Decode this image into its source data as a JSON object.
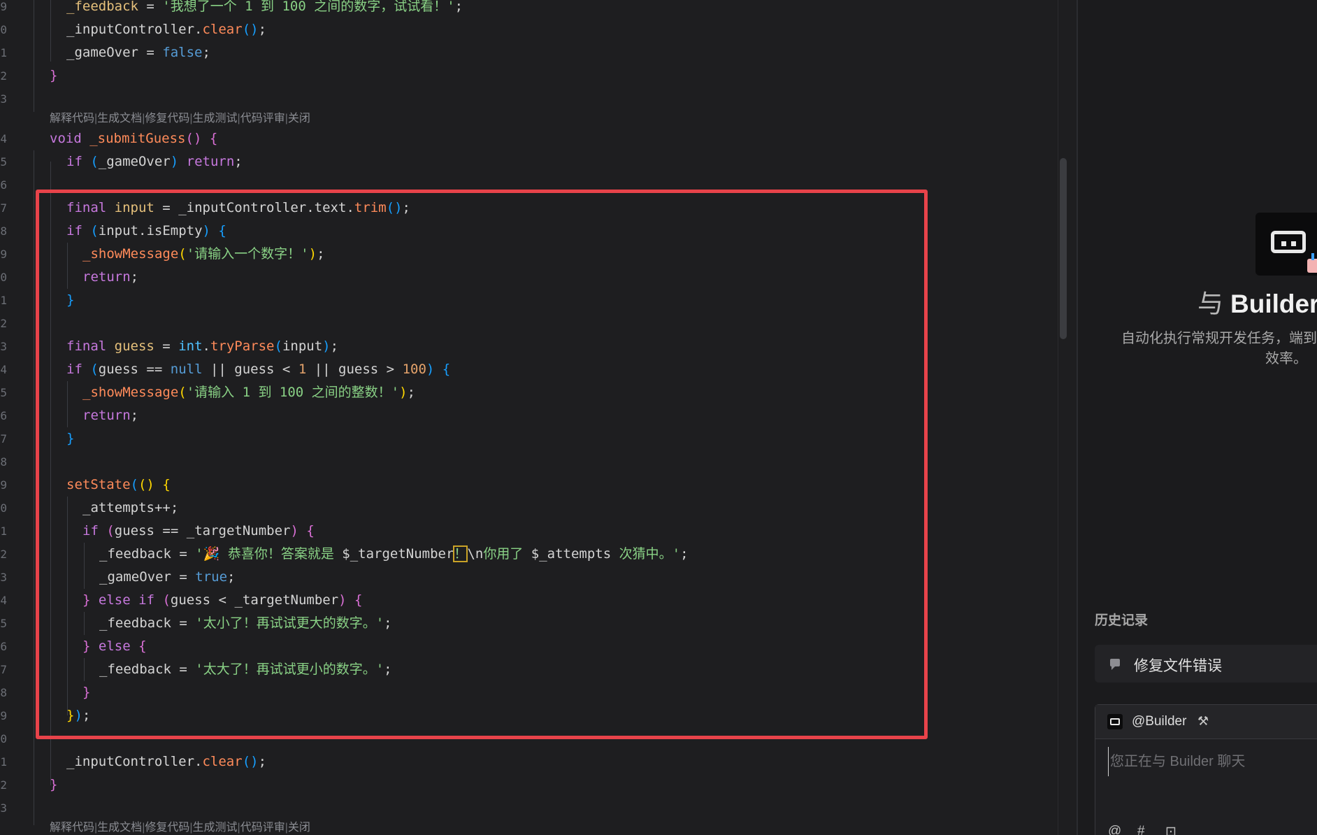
{
  "editor": {
    "line_numbers": [
      "9",
      "0",
      "1",
      "2",
      "3",
      "4",
      "5",
      "6",
      "7",
      "8",
      "9",
      "0",
      "1",
      "2",
      "3",
      "4",
      "5",
      "6",
      "7",
      "8",
      "9",
      "0",
      "1",
      "2",
      "3",
      "4",
      "5",
      "6",
      "7",
      "8",
      "9",
      "0",
      "1",
      "2",
      "3"
    ],
    "code_lens": [
      "解释代码",
      "生成文档",
      "修复代码",
      "生成测试",
      "代码评审",
      "关闭"
    ],
    "code_lens_sep": "|",
    "lines": {
      "l0": {
        "a": "_feedback",
        "b": " = ",
        "c": "'我想了一个 1 到 100 之间的数字，试试看！'",
        "d": ";"
      },
      "l1": {
        "a": "_inputController",
        "b": ".",
        "c": "clear",
        "d": "()",
        "e": ";"
      },
      "l2": {
        "a": "_gameOver",
        "b": " = ",
        "c": "false",
        "d": ";"
      },
      "l3": {
        "a": "}"
      },
      "l5": {
        "a": "void",
        "b": " ",
        "c": "_submitGuess",
        "d": "()",
        "e": " ",
        "f": "{"
      },
      "l6": {
        "a": "if",
        "b": " (",
        "c": "_gameOver",
        "d": ") ",
        "e": "return",
        "f": ";"
      },
      "l8": {
        "a": "final",
        "b": " ",
        "c": "input",
        "d": " = ",
        "e": "_inputController",
        "f": ".",
        "g": "text",
        "h": ".",
        "i": "trim",
        "j": "()",
        "k": ";"
      },
      "l9": {
        "a": "if",
        "b": " (",
        "c": "input",
        "d": ".",
        "e": "isEmpty",
        "f": ") ",
        "g": "{"
      },
      "l10": {
        "a": "_showMessage",
        "b": "(",
        "c": "'请输入一个数字！'",
        "d": ")",
        "e": ";"
      },
      "l11": {
        "a": "return",
        "b": ";"
      },
      "l12": {
        "a": "}"
      },
      "l14": {
        "a": "final",
        "b": " ",
        "c": "guess",
        "d": " = ",
        "e": "int",
        "f": ".",
        "g": "tryParse",
        "h": "(",
        "i": "input",
        "j": ")",
        "k": ";"
      },
      "l15": {
        "a": "if",
        "b": " (",
        "c": "guess",
        "d": " == ",
        "e": "null",
        "f": " || ",
        "g": "guess",
        "h": " < ",
        "i": "1",
        "j": " || ",
        "k": "guess",
        "l": " > ",
        "m": "100",
        "n": ") ",
        "o": "{"
      },
      "l16": {
        "a": "_showMessage",
        "b": "(",
        "c": "'请输入 1 到 100 之间的整数！'",
        "d": ")",
        "e": ";"
      },
      "l17": {
        "a": "return",
        "b": ";"
      },
      "l18": {
        "a": "}"
      },
      "l20": {
        "a": "setState",
        "b": "(",
        "c": "()",
        "d": " ",
        "e": "{"
      },
      "l21": {
        "a": "_attempts",
        "b": "++;"
      },
      "l22": {
        "a": "if",
        "b": " (",
        "c": "guess",
        "d": " == ",
        "e": "_targetNumber",
        "f": ") ",
        "g": "{"
      },
      "l23": {
        "a": "_feedback",
        "b": " = ",
        "c": "'🎉 恭喜你！答案就是 ",
        "d": "$_targetNumber",
        "e": "！",
        "f": "\\n",
        "g": "你用了 ",
        "h": "$_attempts",
        "i": " 次猜中。'",
        "j": ";"
      },
      "l24": {
        "a": "_gameOver",
        "b": " = ",
        "c": "true",
        "d": ";"
      },
      "l25": {
        "a": "}",
        "b": " ",
        "c": "else",
        "d": " ",
        "e": "if",
        "f": " (",
        "g": "guess",
        "h": " < ",
        "i": "_targetNumber",
        "j": ") ",
        "k": "{"
      },
      "l26": {
        "a": "_feedback",
        "b": " = ",
        "c": "'太小了！再试试更大的数字。'",
        "d": ";"
      },
      "l27": {
        "a": "}",
        "b": " ",
        "c": "else",
        "d": " ",
        "e": "{"
      },
      "l28": {
        "a": "_feedback",
        "b": " = ",
        "c": "'太大了！再试试更小的数字。'",
        "d": ";"
      },
      "l29": {
        "a": "}"
      },
      "l30": {
        "a": "}",
        "b": ")",
        "c": ";"
      },
      "l32": {
        "a": "_inputController",
        "b": ".",
        "c": "clear",
        "d": "()",
        "e": ";"
      },
      "l33": {
        "a": "}"
      }
    }
  },
  "panel": {
    "title_glyph": "与",
    "title": "Builder",
    "desc_line1": "自动化执行常规开发任务，端到",
    "desc_line2": "效率。",
    "history_title": "历史记录",
    "history_items": [
      "修复文件错误"
    ],
    "chat_mention": "@Builder",
    "chat_placeholder": "您正在与 Builder 聊天",
    "bottom_icons": [
      "@",
      "#",
      "⊡"
    ],
    "tools_glyph": "⚒"
  },
  "colors": {
    "highlight_border": "#e8434a",
    "editor_bg": "#1e1e20",
    "panel_bg": "#1b1b1d"
  }
}
